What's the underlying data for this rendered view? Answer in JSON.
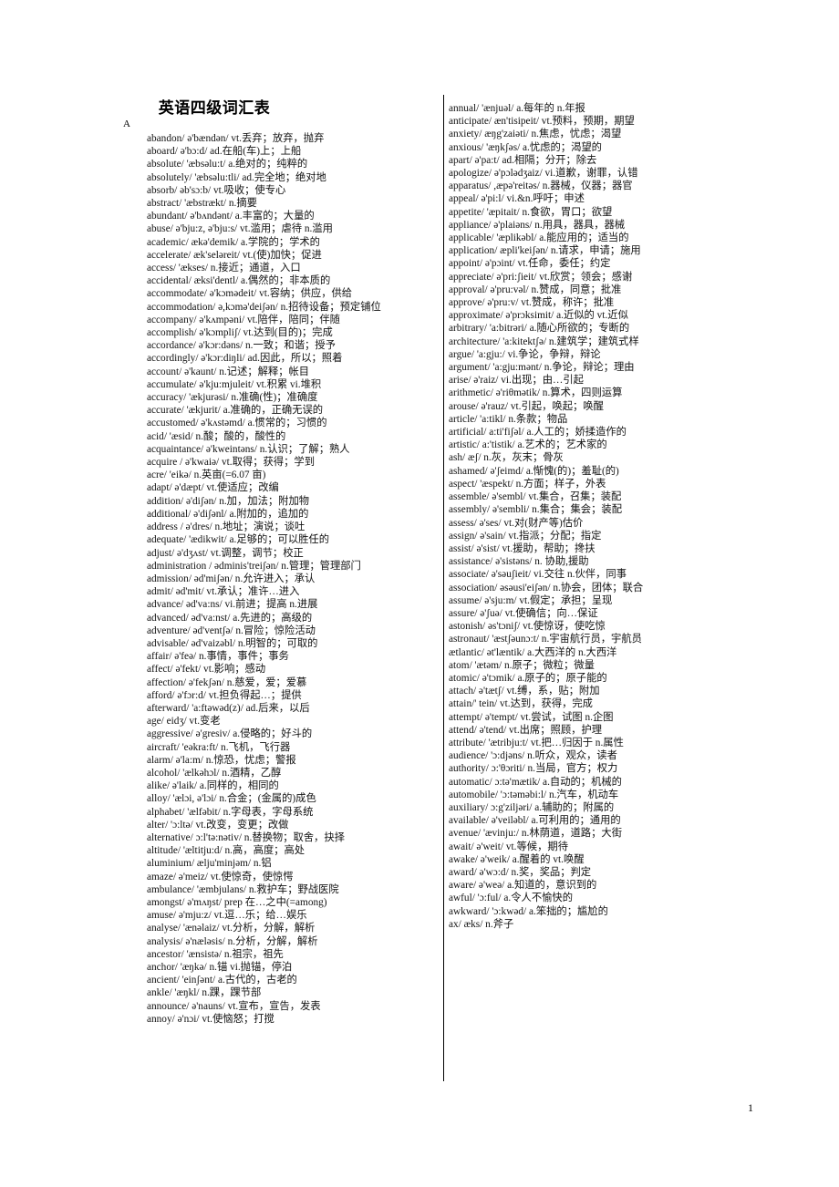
{
  "document": {
    "title": "英语四级词汇表",
    "page_number": "1",
    "section_letter": "A"
  },
  "left_column": [
    "abandon/ ə'bændən/ vt.丢弃；放弃，抛弃",
    "aboard/ ə'bɔ:d/ ad.在船(车)上；上船",
    "absolute/ 'æbsəlu:t/ a.绝对的；纯粹的",
    "absolutely/ 'æbsəlu:tli/ ad.完全地；绝对地",
    "absorb/ əb'sɔ:b/ vt.吸收；使专心",
    "abstract/ 'æbstrækt/ n.摘要",
    "abundant/ ə'bʌndənt/ a.丰富的；大量的",
    "abuse/ ə'bju:z, ə'bju:s/ vt.滥用；虐待 n.滥用",
    "academic/ ækə'demik/ a.学院的；学术的",
    "accelerate/ æk'seləreit/ vt.(使)加快；促进",
    "access/ 'ækses/ n.接近；通道，入口",
    "accidental/ æksi'dentl/ a.偶然的；非本质的",
    "accommodate/ ə'kɔmədeit/ vt.容纳；供应，供给",
    "accommodation/ ə,kɔmə'deiʃən/ n.招待设备；预定铺位",
    "accompany/ ə'kʌmpəni/ vt.陪伴，陪同；伴随",
    "accomplish/ ə'kɔmpliʃ/ vt.达到(目的)；完成",
    "accordance/ ə'kɔr:dəns/ n.一致；和谐；授予",
    "accordingly/ ə'kɔr:diŋli/ ad.因此，所以；照着",
    "account/ ə'kaunt/ n.记述；解释；帐目",
    "accumulate/ ə'kju:mjuleit/ vt.积累 vi.堆积",
    "accuracy/ 'ækjurəsi/ n.准确(性)；准确度",
    "accurate/ 'ækjurit/ a.准确的，正确无误的",
    "accustomed/ ə'kʌstəmd/ a.惯常的；习惯的",
    "acid/ 'æsid/ n.酸；酸的，酸性的",
    "acquaintance/ ə'kweintəns/ n.认识；了解；熟人",
    "acquire / ə'kwaiə/ vt.取得；获得；学到",
    "acre/ 'eikə/ n.英亩(=6.07 亩)",
    "adapt/ ə'dæpt/ vt.使适应；改编",
    "addition/ ə'diʃən/ n.加，加法；附加物",
    "additional/ ə'diʃənl/ a.附加的，追加的",
    "address / ə'dres/ n.地址；演说；谈吐",
    "adequate/ 'ædikwit/ a.足够的；可以胜任的",
    "adjust/ ə'dʒʌst/ vt.调整，调节；校正",
    "administration / ədminis'treiʃən/ n.管理；管理部门",
    "admission/ əd'miʃən/ n.允许进入；承认",
    "admit/ əd'mit/ vt.承认；准许…进入",
    "advance/ əd'va:ns/ vi.前进；提高 n.进展",
    "advanced/ əd'va:nst/ a.先进的；高级的",
    "adventure/ əd'ventʃə/ n.冒险；惊险活动",
    "advisable/ əd'vaizəbl/ n.明智的；可取的",
    "affair/ ə'feə/ n.事情，事件；事务",
    "affect/ ə'fekt/ vt.影响；感动",
    "affection/ ə'fekʃən/ n.慈爱，爱；爱慕",
    "afford/ ə'fɔr:d/ vt.担负得起…；提供",
    "afterward/ 'a:ftəwəd(z)/ ad.后来，以后",
    "age/ eidʒ/ vt.变老",
    "aggressive/ ə'gresiv/ a.侵略的；好斗的",
    "aircraft/ 'eəkra:ft/ n.飞机，飞行器",
    "alarm/ ə'la:m/ n.惊恐，忧虑；警报",
    "alcohol/ 'ælkəhɔl/ n.酒精，乙醇",
    "alike/ ə'laik/ a.同样的，相同的",
    "alloy/ 'ælɔi, ə'lɔi/ n.合金；(金属的)成色",
    "alphabet/ 'ælfəbit/ n.字母表，字母系统",
    "alter/ 'ɔ:ltə/ vt.改变，变更；改做",
    "alternative/ ɔ:l'tə:nətiv/ n.替换物；取舍，抉择",
    "altitude/ 'æltitju:d/ n.高，高度；高处",
    "aluminium/ ælju'minjəm/ n.铝",
    "amaze/ ə'meiz/ vt.使惊奇，使惊愕",
    "ambulance/ 'æmbjulans/ n.救护车；野战医院",
    "amongst/ ə'mʌŋst/ prep 在…之中(=among)",
    "amuse/ ə'mju:z/ vt.逗…乐；给…娱乐",
    "analyse/ 'ænəlaiz/ vt.分析，分解，解析",
    "analysis/ ə'næləsis/ n.分析，分解，解析",
    "ancestor/ 'ænsistə/ n.祖宗，祖先",
    "anchor/ 'æŋkə/ n.锚 vi.抛锚，停泊",
    "ancient/ 'einʃənt/ a.古代的，古老的",
    "ankle/ 'æŋkl/ n.踝，踝节部",
    "announce/ ə'nauns/ vt.宣布，宣告，发表",
    "annoy/ ə'nɔi/ vt.使恼怒；打搅"
  ],
  "right_column": [
    "annual/ 'ænjuəl/ a.每年的 n.年报",
    "anticipate/ æn'tisipeit/ vt.预料，预期，期望",
    "anxiety/ æŋg'zaiəti/ n.焦虑，忧虑；渴望",
    "anxious/ 'æŋkʃəs/ a.忧虑的；渴望的",
    "apart/ ə'pa:t/ ad.相隔；分开；除去",
    "apologize/ ə'pɔlədʒaiz/ vi.道歉，谢罪，认错",
    "apparatus/ ,æpə'reitəs/ n.器械，仪器；器官",
    "appeal/ ə'pi:l/ vi.&n.呼吁；申述",
    "appetite/ 'æpitait/ n.食欲，胃口；欲望",
    "appliance/ ə'plaiəns/ n.用具，器具，器械",
    "applicable/ 'æplikəbl/ a.能应用的；适当的",
    "application/ æpli'keiʃən/ n.请求，申请；施用",
    "appoint/ ə'pɔint/ vt.任命，委任；约定",
    "appreciate/ ə'pri:ʃieit/ vt.欣赏；领会；感谢",
    "approval/ ə'pru:vəl/ n.赞成，同意；批准",
    "approve/ ə'pru:v/ vt.赞成，称许；批准",
    "approximate/ ə'prɔksimit/ a.近似的 vt.近似",
    "arbitrary/ 'a:bitrəri/ a.随心所欲的；专断的",
    "architecture/ 'a:kitektʃə/ n.建筑学；建筑式样",
    "argue/ 'a:gju:/ vi.争论，争辩，辩论",
    "argument/ 'a:gju:mənt/ n.争论，辩论；理由",
    "arise/ ə'raiz/ vi.出现；由…引起",
    "arithmetic/ ə'riθmətik/ n.算术，四则运算",
    "arouse/ ə'rauz/ vt.引起，唤起；唤醒",
    "article/ 'a:tikl/ n.条款；物品",
    "artificial/ a:ti'fiʃəl/ a.人工的；娇揉造作的",
    "artistic/ a:'tistik/ a.艺术的；艺术家的",
    "ash/ æʃ/ n.灰，灰末；骨灰",
    "ashamed/ ə'ʃeimd/ a.惭愧(的)；羞耻(的)",
    "aspect/ 'æspekt/ n.方面；样子，外表",
    "assemble/ ə'sembl/ vt.集合，召集；装配",
    "assembly/ ə'sembli/ n.集合；集会；装配",
    "assess/ ə'ses/ vt.对(财产等)估价",
    "assign/ ə'sain/ vt.指派；分配；指定",
    "assist/ ə'sist/ vt.援助，帮助；搀扶",
    "assistance/ ə'sistəns/ n. 协助,援助",
    "associate/ ə'səuʃieit/ vi.交往 n.伙伴，同事",
    "association/ əsəusi'eiʃən/ n.协会，团体；联合",
    "assume/ ə'sju:m/ vt.假定；承担；呈现",
    "assure/ ə'ʃuə/ vt.使确信；向…保证",
    "astonish/ əs'tɔniʃ/ vt.使惊讶，使吃惊",
    "astronaut/ 'æstʃəunɔ:t/ n.宇宙航行员，宇航员",
    "ætlantic/ ət'læntik/ a.大西洋的 n.大西洋",
    "atom/ 'ætəm/ n.原子；微粒；微量",
    "atomic/ ə'tɔmik/ a.原子的；原子能的",
    "attach/ ə'tætʃ/ vt.缚，系，贴；附加",
    "attain/' tein/ vt.达到，获得，完成",
    "attempt/ ə'tempt/ vt.尝试，试图 n.企图",
    "attend/ ə'tend/ vt.出席；照顾，护理",
    "attribute/ 'ætribju:t/ vt.把…归因于 n.属性",
    "audience/ 'ɔ:djəns/ n.听众，观众，读者",
    "authority/ ɔ:'θɔriti/ n.当局，官方；权力",
    "automatic/ ɔ:tə'mætik/ a.自动的；机械的",
    "automobile/ 'ɔ:təməbi:l/ n.汽车，机动车",
    "auxiliary/ ɔ:g'ziljəri/ a.辅助的；附属的",
    "available/ ə'veiləbl/ a.可利用的；通用的",
    "avenue/ 'ævinju:/ n.林荫道，道路；大街",
    "await/ ə'weit/ vt.等候，期待",
    "awake/ ə'weik/ a.醒着的 vt.唤醒",
    "award/ ə'wɔ:d/ n.奖，奖品；判定",
    "aware/ ə'weə/ a.知道的，意识到的",
    "awful/ 'ɔ:ful/ a.令人不愉快的",
    "awkward/ 'ɔ:kwəd/ a.笨拙的；尴尬的",
    "ax/ æks/ n.斧子"
  ]
}
